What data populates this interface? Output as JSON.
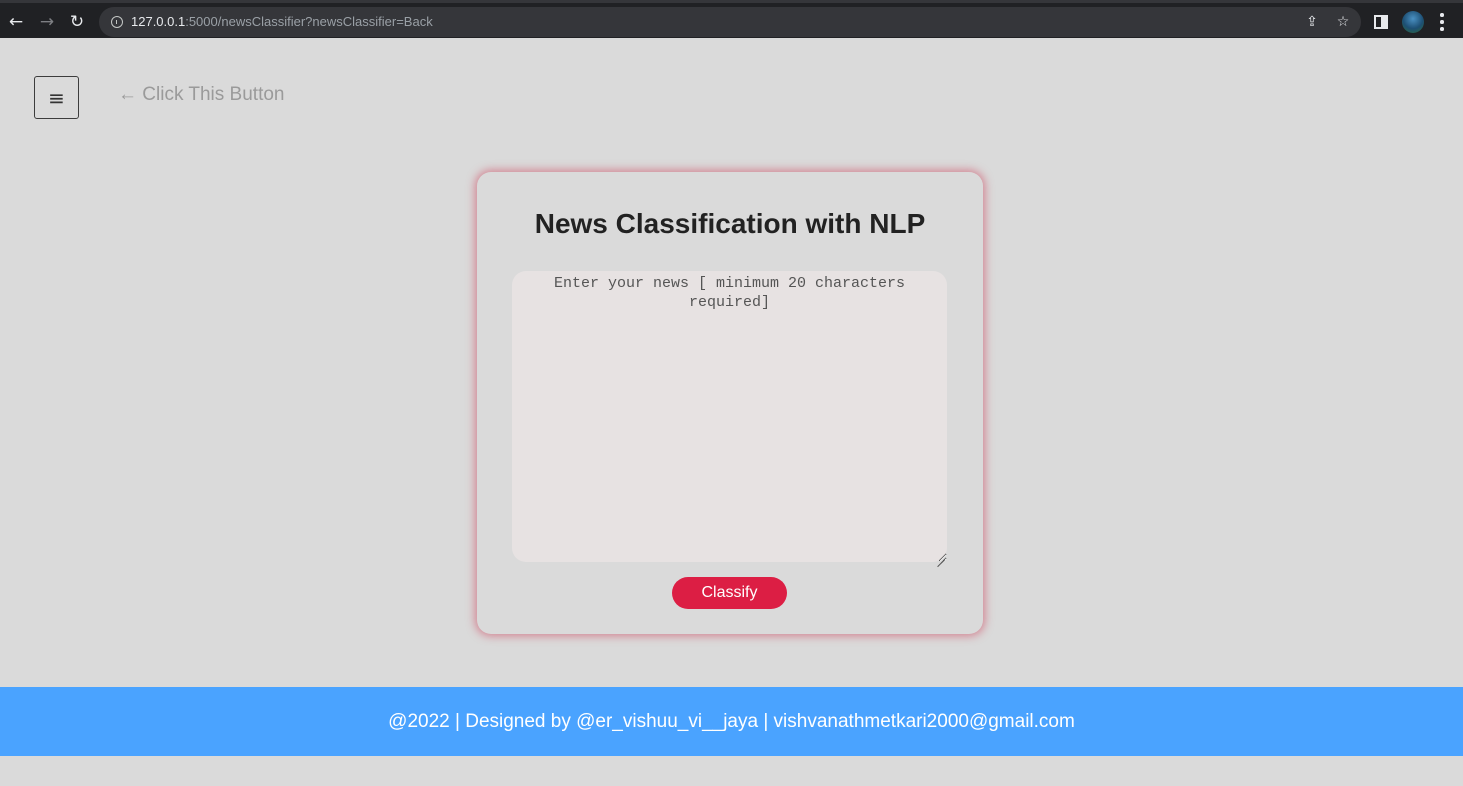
{
  "browser": {
    "url_host": "127.0.0.1",
    "url_rest": ":5000/newsClassifier?newsClassifier=Back",
    "icons": [
      "back-arrow-icon",
      "forward-arrow-icon",
      "reload-icon",
      "info-icon",
      "share-icon",
      "star-icon",
      "side-panel-icon",
      "profile-avatar",
      "more-menu-icon"
    ]
  },
  "header": {
    "menu_icon": "≡",
    "hint": "← Click This Button"
  },
  "card": {
    "title": "News Classification with NLP",
    "input_placeholder": "Enter your news [ minimum 20 characters required]",
    "input_value": "",
    "button_label": "Classify"
  },
  "footer": {
    "text": "@2022 | Designed by @er_vishuu_vi__jaya | vishvanathmetkari2000@gmail.com"
  },
  "colors": {
    "page_background": "#dadada",
    "accent_red": "#dc1e44",
    "footer_blue": "#4aa3ff",
    "browser_dark": "#202124"
  }
}
